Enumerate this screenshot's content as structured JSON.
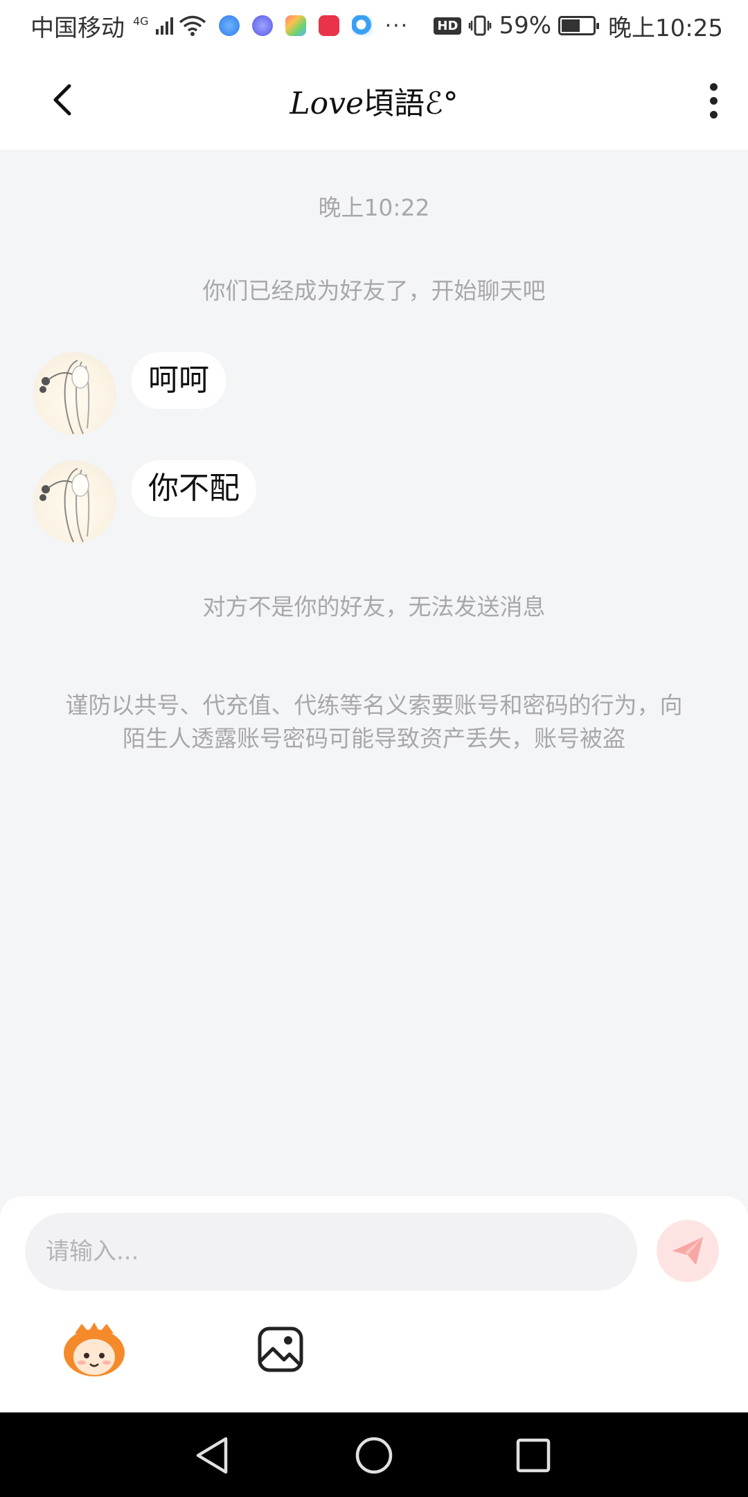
{
  "status_bar": {
    "carrier": "中国移动",
    "network": "4G",
    "battery": "59%",
    "battery_level": 0.59,
    "hd": "HD",
    "time": "晚上10:25",
    "more": "···",
    "app_icons": [
      "browser-icon",
      "music-icon",
      "theme-icon",
      "huawei-store-icon",
      "search-app-icon"
    ]
  },
  "header": {
    "title_latin": "Love",
    "title_cjk": "頃語",
    "title_suffix": "ℰ°"
  },
  "messages": {
    "timestamp": "晚上10:22",
    "friend_notice": "你们已经成为好友了，开始聊天吧",
    "items": [
      {
        "text": "呵呵"
      },
      {
        "text": "你不配"
      }
    ],
    "not_friend_notice": "对方不是你的好友，无法发送消息",
    "warning": "谨防以共号、代充值、代练等名义索要账号和密码的行为，向陌生人透露账号密码可能导致资产丢失，账号被盗"
  },
  "input": {
    "placeholder": "请输入..."
  },
  "colors": {
    "background": "#f4f5f7",
    "send_button": "#fde4e3",
    "send_icon": "#f7a7a3",
    "system_text": "#a8a8ac"
  }
}
